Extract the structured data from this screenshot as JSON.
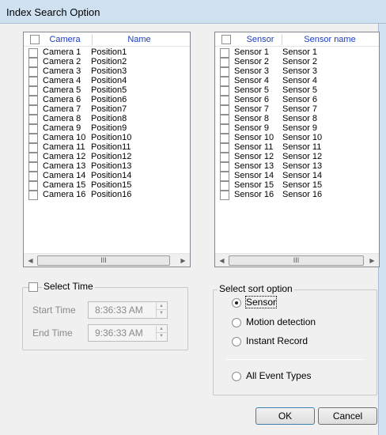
{
  "window": {
    "title": "Index Search Option"
  },
  "camera_list": {
    "header": {
      "col1": "Camera",
      "col2": "Name"
    },
    "rows": [
      {
        "id": "Camera 1",
        "name": "Position1"
      },
      {
        "id": "Camera 2",
        "name": "Position2"
      },
      {
        "id": "Camera 3",
        "name": "Position3"
      },
      {
        "id": "Camera 4",
        "name": "Position4"
      },
      {
        "id": "Camera 5",
        "name": "Position5"
      },
      {
        "id": "Camera 6",
        "name": "Position6"
      },
      {
        "id": "Camera 7",
        "name": "Position7"
      },
      {
        "id": "Camera 8",
        "name": "Position8"
      },
      {
        "id": "Camera 9",
        "name": "Position9"
      },
      {
        "id": "Camera 10",
        "name": "Position10"
      },
      {
        "id": "Camera 11",
        "name": "Position11"
      },
      {
        "id": "Camera 12",
        "name": "Position12"
      },
      {
        "id": "Camera 13",
        "name": "Position13"
      },
      {
        "id": "Camera 14",
        "name": "Position14"
      },
      {
        "id": "Camera 15",
        "name": "Position15"
      },
      {
        "id": "Camera 16",
        "name": "Position16"
      }
    ],
    "scroll_thumb": "III"
  },
  "sensor_list": {
    "header": {
      "col1": "Sensor",
      "col2": "Sensor name"
    },
    "rows": [
      {
        "id": "Sensor 1",
        "name": "Sensor 1"
      },
      {
        "id": "Sensor 2",
        "name": "Sensor 2"
      },
      {
        "id": "Sensor 3",
        "name": "Sensor 3"
      },
      {
        "id": "Sensor 4",
        "name": "Sensor 4"
      },
      {
        "id": "Sensor 5",
        "name": "Sensor 5"
      },
      {
        "id": "Sensor 6",
        "name": "Sensor 6"
      },
      {
        "id": "Sensor 7",
        "name": "Sensor 7"
      },
      {
        "id": "Sensor 8",
        "name": "Sensor 8"
      },
      {
        "id": "Sensor 9",
        "name": "Sensor 9"
      },
      {
        "id": "Sensor 10",
        "name": "Sensor 10"
      },
      {
        "id": "Sensor 11",
        "name": "Sensor 11"
      },
      {
        "id": "Sensor 12",
        "name": "Sensor 12"
      },
      {
        "id": "Sensor 13",
        "name": "Sensor 13"
      },
      {
        "id": "Sensor 14",
        "name": "Sensor 14"
      },
      {
        "id": "Sensor 15",
        "name": "Sensor 15"
      },
      {
        "id": "Sensor 16",
        "name": "Sensor 16"
      }
    ],
    "scroll_thumb": "III"
  },
  "select_time": {
    "label": "Select Time",
    "checked": false,
    "start_label": "Start Time",
    "start_value": "8:36:33 AM",
    "end_label": "End Time",
    "end_value": "9:36:33 AM"
  },
  "sort_option": {
    "legend": "Select sort option",
    "options": [
      {
        "label": "Sensor",
        "selected": true
      },
      {
        "label": "Motion detection",
        "selected": false
      },
      {
        "label": "Instant Record",
        "selected": false
      }
    ],
    "all_events": {
      "label": "All Event Types",
      "selected": false
    }
  },
  "buttons": {
    "ok": "OK",
    "cancel": "Cancel"
  },
  "icons": {
    "scroll_left": "chevron-left-icon",
    "scroll_right": "chevron-right-icon",
    "spin_up": "spin-up-icon",
    "spin_down": "spin-down-icon"
  },
  "colors": {
    "header_text": "#1a3cc2",
    "titlebar": "#cfe0f1"
  }
}
